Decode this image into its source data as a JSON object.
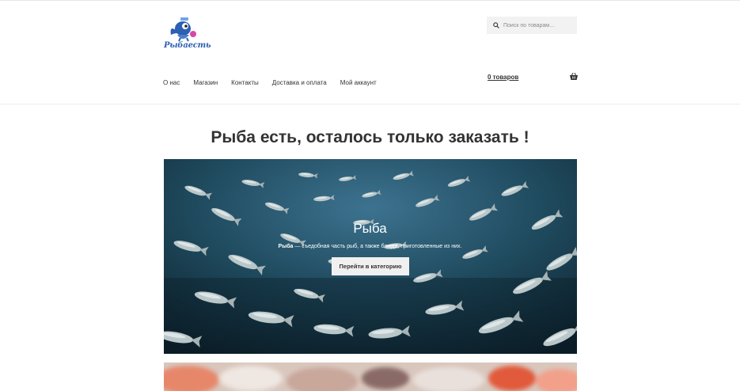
{
  "brand": {
    "logo_text": "Рыбаесть"
  },
  "search": {
    "placeholder": "Поиск по товарам…"
  },
  "nav": {
    "items": [
      {
        "label": "О нас"
      },
      {
        "label": "Магазин"
      },
      {
        "label": "Контакты"
      },
      {
        "label": "Доставка и оплата"
      },
      {
        "label": "Мой аккаунт"
      }
    ]
  },
  "cart": {
    "count_label": "0 товаров",
    "icon": "basket-icon"
  },
  "headline": "Рыба есть, осталось только заказать !",
  "hero": {
    "title": "Рыба",
    "desc_bold": "Рыба",
    "desc_rest": " — съедобная часть рыб, а также блюда, приготовленные из них.",
    "button_label": "Перейти в категорию"
  },
  "colors": {
    "accent": "#2d5fb3",
    "logo_pink": "#d946a8",
    "ocean": "#1f4a5e"
  }
}
